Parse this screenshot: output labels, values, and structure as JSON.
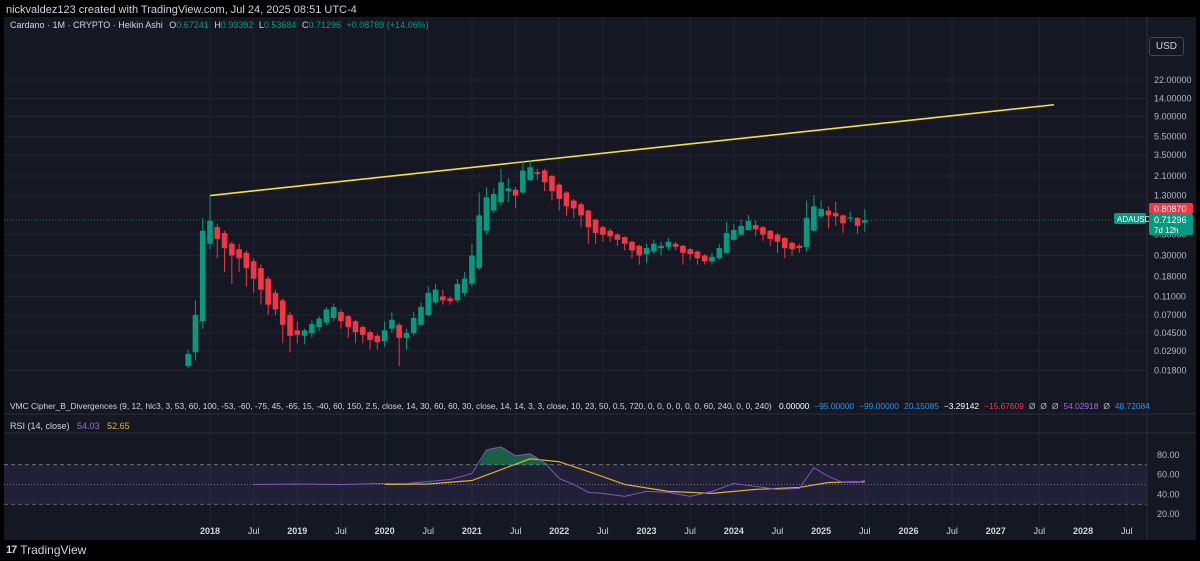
{
  "header": {
    "caption": "nickvaldez123 created with TradingView.com, Jul 24, 2025 08:51 UTC-4"
  },
  "symbol_info": {
    "symbol": "Cardano · 1M · CRYPTO · Heikin Ashi",
    "o_label": "O",
    "o": "0.67241",
    "h_label": "H",
    "h": "0.93392",
    "l_label": "L",
    "l": "0.53684",
    "c_label": "C",
    "c": "0.71296",
    "change": "+0.08789 (+14.06%)"
  },
  "currency_button": "USD",
  "price_labels": {
    "red_value": "0.80870",
    "ticker": "ADAUSD",
    "green_value": "0.71296",
    "countdown": "7d 12h"
  },
  "indicator1": {
    "text": "VMC Cipher_B_Divergences (9, 12, hlc3, 3, 53, 60, 100, -53, -60, -75, 45, -65, 15, -40, 60, 150, 2.5, close, 14, 30, 60, 60, 30, close, 14, 14, 3, 3, close, 10, 23, 50, 0.5, 720, 0, 0, 0, 0, 0, 0, 60, 240, 0, 0, 240)",
    "values": [
      {
        "t": "0.00000",
        "c": "#ffffff"
      },
      {
        "t": "−95.00000",
        "c": "#2196f3"
      },
      {
        "t": "−99.00000",
        "c": "#2196f3"
      },
      {
        "t": "20.15085",
        "c": "#2196f3"
      },
      {
        "t": "−3.29142",
        "c": "#ffffff"
      },
      {
        "t": "−15.67609",
        "c": "#f23645"
      },
      {
        "t": "Ø",
        "c": "#b2b5be"
      },
      {
        "t": "Ø",
        "c": "#b2b5be"
      },
      {
        "t": "Ø",
        "c": "#b2b5be"
      },
      {
        "t": "54.02918",
        "c": "#9c6ade"
      },
      {
        "t": "Ø",
        "c": "#b2b5be"
      },
      {
        "t": "48.72084",
        "c": "#2196f3"
      }
    ]
  },
  "rsi_legend": {
    "label": "RSI (14, close)",
    "rsi": "54.03",
    "ma": "52.65"
  },
  "footer": {
    "brand": "TradingView",
    "logo_text": "17"
  },
  "colors": {
    "bg": "#151823",
    "up": "#089981",
    "down": "#f23645",
    "trendline": "#f7e034",
    "rsi": "#7e57c2",
    "rsi_ma": "#d8b13a"
  },
  "chart_data": [
    {
      "type": "candlestick",
      "title": "Cardano · 1M · CRYPTO · Heikin Ashi",
      "style": "Heikin Ashi",
      "yscale": "log",
      "ylim": [
        0.012,
        60
      ],
      "xlim": [
        "2017-08",
        "2028-11"
      ],
      "grid": true,
      "y_ticks": [
        "22.00000",
        "14.00000",
        "9.00000",
        "5.50000",
        "3.50000",
        "2.10000",
        "1.30000",
        "0.50000",
        "0.30000",
        "0.18000",
        "0.11000",
        "0.07000",
        "0.04500",
        "0.02900",
        "0.01800"
      ],
      "x_ticks": [
        "2018",
        "Jul",
        "2019",
        "Jul",
        "2020",
        "Jul",
        "2021",
        "Jul",
        "2022",
        "Jul",
        "2023",
        "Jul",
        "2024",
        "Jul",
        "2025",
        "Jul",
        "2026",
        "Jul",
        "2027",
        "Jul",
        "2028",
        "Jul"
      ],
      "trendline": {
        "from": {
          "x": "2018-01",
          "y": 1.3
        },
        "to": {
          "x": "2027-09",
          "y": 12
        }
      },
      "candles": [
        {
          "x": "2017-10",
          "o": 0.02,
          "h": 0.03,
          "l": 0.019,
          "c": 0.027
        },
        {
          "x": "2017-11",
          "o": 0.028,
          "h": 0.1,
          "l": 0.023,
          "c": 0.07
        },
        {
          "x": "2017-12",
          "o": 0.06,
          "h": 0.75,
          "l": 0.05,
          "c": 0.55
        },
        {
          "x": "2018-01",
          "o": 0.4,
          "h": 1.3,
          "l": 0.35,
          "c": 0.7
        },
        {
          "x": "2018-02",
          "o": 0.6,
          "h": 0.65,
          "l": 0.28,
          "c": 0.45
        },
        {
          "x": "2018-03",
          "o": 0.52,
          "h": 0.55,
          "l": 0.2,
          "c": 0.36
        },
        {
          "x": "2018-04",
          "o": 0.4,
          "h": 0.42,
          "l": 0.15,
          "c": 0.3
        },
        {
          "x": "2018-05",
          "o": 0.35,
          "h": 0.4,
          "l": 0.2,
          "c": 0.28
        },
        {
          "x": "2018-06",
          "o": 0.32,
          "h": 0.34,
          "l": 0.14,
          "c": 0.22
        },
        {
          "x": "2018-07",
          "o": 0.26,
          "h": 0.28,
          "l": 0.12,
          "c": 0.17
        },
        {
          "x": "2018-08",
          "o": 0.22,
          "h": 0.24,
          "l": 0.09,
          "c": 0.13
        },
        {
          "x": "2018-09",
          "o": 0.17,
          "h": 0.18,
          "l": 0.07,
          "c": 0.09
        },
        {
          "x": "2018-10",
          "o": 0.12,
          "h": 0.13,
          "l": 0.07,
          "c": 0.08
        },
        {
          "x": "2018-11",
          "o": 0.1,
          "h": 0.105,
          "l": 0.035,
          "c": 0.055
        },
        {
          "x": "2018-12",
          "o": 0.07,
          "h": 0.075,
          "l": 0.028,
          "c": 0.042
        },
        {
          "x": "2019-01",
          "o": 0.048,
          "h": 0.06,
          "l": 0.035,
          "c": 0.043
        },
        {
          "x": "2019-02",
          "o": 0.042,
          "h": 0.05,
          "l": 0.034,
          "c": 0.048
        },
        {
          "x": "2019-03",
          "o": 0.045,
          "h": 0.062,
          "l": 0.04,
          "c": 0.056
        },
        {
          "x": "2019-04",
          "o": 0.052,
          "h": 0.068,
          "l": 0.047,
          "c": 0.064
        },
        {
          "x": "2019-05",
          "o": 0.058,
          "h": 0.085,
          "l": 0.055,
          "c": 0.08
        },
        {
          "x": "2019-06",
          "o": 0.065,
          "h": 0.092,
          "l": 0.06,
          "c": 0.085
        },
        {
          "x": "2019-07",
          "o": 0.075,
          "h": 0.08,
          "l": 0.05,
          "c": 0.06
        },
        {
          "x": "2019-08",
          "o": 0.068,
          "h": 0.07,
          "l": 0.04,
          "c": 0.052
        },
        {
          "x": "2019-09",
          "o": 0.06,
          "h": 0.062,
          "l": 0.035,
          "c": 0.046
        },
        {
          "x": "2019-10",
          "o": 0.052,
          "h": 0.054,
          "l": 0.035,
          "c": 0.043
        },
        {
          "x": "2019-11",
          "o": 0.046,
          "h": 0.048,
          "l": 0.03,
          "c": 0.038
        },
        {
          "x": "2019-12",
          "o": 0.042,
          "h": 0.044,
          "l": 0.03,
          "c": 0.036
        },
        {
          "x": "2020-01",
          "o": 0.037,
          "h": 0.06,
          "l": 0.032,
          "c": 0.048
        },
        {
          "x": "2020-02",
          "o": 0.05,
          "h": 0.075,
          "l": 0.045,
          "c": 0.062
        },
        {
          "x": "2020-03",
          "o": 0.055,
          "h": 0.058,
          "l": 0.02,
          "c": 0.04
        },
        {
          "x": "2020-04",
          "o": 0.04,
          "h": 0.05,
          "l": 0.03,
          "c": 0.045
        },
        {
          "x": "2020-05",
          "o": 0.045,
          "h": 0.075,
          "l": 0.042,
          "c": 0.065
        },
        {
          "x": "2020-06",
          "o": 0.055,
          "h": 0.095,
          "l": 0.053,
          "c": 0.085
        },
        {
          "x": "2020-07",
          "o": 0.07,
          "h": 0.14,
          "l": 0.068,
          "c": 0.12
        },
        {
          "x": "2020-08",
          "o": 0.095,
          "h": 0.15,
          "l": 0.09,
          "c": 0.13
        },
        {
          "x": "2020-09",
          "o": 0.11,
          "h": 0.13,
          "l": 0.09,
          "c": 0.1
        },
        {
          "x": "2020-10",
          "o": 0.105,
          "h": 0.11,
          "l": 0.09,
          "c": 0.098
        },
        {
          "x": "2020-11",
          "o": 0.1,
          "h": 0.17,
          "l": 0.095,
          "c": 0.15
        },
        {
          "x": "2020-12",
          "o": 0.12,
          "h": 0.2,
          "l": 0.11,
          "c": 0.17
        },
        {
          "x": "2021-01",
          "o": 0.15,
          "h": 0.4,
          "l": 0.14,
          "c": 0.3
        },
        {
          "x": "2021-02",
          "o": 0.22,
          "h": 1.4,
          "l": 0.21,
          "c": 0.8
        },
        {
          "x": "2021-03",
          "o": 0.55,
          "h": 1.6,
          "l": 0.5,
          "c": 1.25
        },
        {
          "x": "2021-04",
          "o": 0.9,
          "h": 1.55,
          "l": 0.85,
          "c": 1.35
        },
        {
          "x": "2021-05",
          "o": 1.1,
          "h": 2.5,
          "l": 1.0,
          "c": 1.8
        },
        {
          "x": "2021-06",
          "o": 1.45,
          "h": 2.0,
          "l": 1.1,
          "c": 1.55
        },
        {
          "x": "2021-07",
          "o": 1.5,
          "h": 1.6,
          "l": 0.95,
          "c": 1.3
        },
        {
          "x": "2021-08",
          "o": 1.4,
          "h": 3.0,
          "l": 1.35,
          "c": 2.4
        },
        {
          "x": "2021-09",
          "o": 1.9,
          "h": 3.1,
          "l": 1.85,
          "c": 2.6
        },
        {
          "x": "2021-10",
          "o": 2.3,
          "h": 2.5,
          "l": 1.9,
          "c": 2.2
        },
        {
          "x": "2021-11",
          "o": 2.4,
          "h": 2.5,
          "l": 1.45,
          "c": 1.8
        },
        {
          "x": "2021-12",
          "o": 2.1,
          "h": 2.15,
          "l": 1.15,
          "c": 1.45
        },
        {
          "x": "2022-01",
          "o": 1.7,
          "h": 1.75,
          "l": 0.9,
          "c": 1.2
        },
        {
          "x": "2022-02",
          "o": 1.4,
          "h": 1.45,
          "l": 0.8,
          "c": 1.0
        },
        {
          "x": "2022-03",
          "o": 1.15,
          "h": 1.2,
          "l": 0.75,
          "c": 0.95
        },
        {
          "x": "2022-04",
          "o": 1.05,
          "h": 1.1,
          "l": 0.6,
          "c": 0.8
        },
        {
          "x": "2022-05",
          "o": 0.9,
          "h": 0.92,
          "l": 0.4,
          "c": 0.6
        },
        {
          "x": "2022-06",
          "o": 0.72,
          "h": 0.74,
          "l": 0.4,
          "c": 0.52
        },
        {
          "x": "2022-07",
          "o": 0.6,
          "h": 0.62,
          "l": 0.42,
          "c": 0.5
        },
        {
          "x": "2022-08",
          "o": 0.55,
          "h": 0.58,
          "l": 0.42,
          "c": 0.48
        },
        {
          "x": "2022-09",
          "o": 0.5,
          "h": 0.52,
          "l": 0.38,
          "c": 0.44
        },
        {
          "x": "2022-10",
          "o": 0.47,
          "h": 0.48,
          "l": 0.34,
          "c": 0.4
        },
        {
          "x": "2022-11",
          "o": 0.42,
          "h": 0.43,
          "l": 0.28,
          "c": 0.34
        },
        {
          "x": "2022-12",
          "o": 0.38,
          "h": 0.39,
          "l": 0.24,
          "c": 0.3
        },
        {
          "x": "2023-01",
          "o": 0.31,
          "h": 0.4,
          "l": 0.25,
          "c": 0.36
        },
        {
          "x": "2023-02",
          "o": 0.33,
          "h": 0.44,
          "l": 0.31,
          "c": 0.4
        },
        {
          "x": "2023-03",
          "o": 0.36,
          "h": 0.42,
          "l": 0.3,
          "c": 0.38
        },
        {
          "x": "2023-04",
          "o": 0.37,
          "h": 0.46,
          "l": 0.34,
          "c": 0.42
        },
        {
          "x": "2023-05",
          "o": 0.4,
          "h": 0.42,
          "l": 0.34,
          "c": 0.37
        },
        {
          "x": "2023-06",
          "o": 0.38,
          "h": 0.39,
          "l": 0.24,
          "c": 0.32
        },
        {
          "x": "2023-07",
          "o": 0.35,
          "h": 0.36,
          "l": 0.27,
          "c": 0.31
        },
        {
          "x": "2023-08",
          "o": 0.33,
          "h": 0.34,
          "l": 0.24,
          "c": 0.28
        },
        {
          "x": "2023-09",
          "o": 0.3,
          "h": 0.31,
          "l": 0.24,
          "c": 0.26
        },
        {
          "x": "2023-10",
          "o": 0.26,
          "h": 0.32,
          "l": 0.24,
          "c": 0.29
        },
        {
          "x": "2023-11",
          "o": 0.28,
          "h": 0.4,
          "l": 0.27,
          "c": 0.36
        },
        {
          "x": "2023-12",
          "o": 0.32,
          "h": 0.68,
          "l": 0.31,
          "c": 0.52
        },
        {
          "x": "2024-01",
          "o": 0.44,
          "h": 0.65,
          "l": 0.43,
          "c": 0.56
        },
        {
          "x": "2024-02",
          "o": 0.5,
          "h": 0.72,
          "l": 0.48,
          "c": 0.62
        },
        {
          "x": "2024-03",
          "o": 0.56,
          "h": 0.81,
          "l": 0.55,
          "c": 0.7
        },
        {
          "x": "2024-04",
          "o": 0.63,
          "h": 0.7,
          "l": 0.48,
          "c": 0.57
        },
        {
          "x": "2024-05",
          "o": 0.6,
          "h": 0.62,
          "l": 0.43,
          "c": 0.5
        },
        {
          "x": "2024-06",
          "o": 0.55,
          "h": 0.56,
          "l": 0.38,
          "c": 0.45
        },
        {
          "x": "2024-07",
          "o": 0.5,
          "h": 0.52,
          "l": 0.32,
          "c": 0.42
        },
        {
          "x": "2024-08",
          "o": 0.46,
          "h": 0.47,
          "l": 0.28,
          "c": 0.36
        },
        {
          "x": "2024-09",
          "o": 0.41,
          "h": 0.42,
          "l": 0.3,
          "c": 0.35
        },
        {
          "x": "2024-10",
          "o": 0.38,
          "h": 0.4,
          "l": 0.32,
          "c": 0.36
        },
        {
          "x": "2024-11",
          "o": 0.37,
          "h": 1.15,
          "l": 0.33,
          "c": 0.75
        },
        {
          "x": "2024-12",
          "o": 0.55,
          "h": 1.32,
          "l": 0.54,
          "c": 1.0
        },
        {
          "x": "2025-01",
          "o": 0.78,
          "h": 1.15,
          "l": 0.74,
          "c": 0.94
        },
        {
          "x": "2025-02",
          "o": 0.9,
          "h": 1.0,
          "l": 0.58,
          "c": 0.8
        },
        {
          "x": "2025-03",
          "o": 0.85,
          "h": 1.12,
          "l": 0.62,
          "c": 0.78
        },
        {
          "x": "2025-04",
          "o": 0.8,
          "h": 0.82,
          "l": 0.52,
          "c": 0.66
        },
        {
          "x": "2025-05",
          "o": 0.74,
          "h": 0.88,
          "l": 0.68,
          "c": 0.76
        },
        {
          "x": "2025-06",
          "o": 0.75,
          "h": 0.77,
          "l": 0.51,
          "c": 0.62
        },
        {
          "x": "2025-07",
          "o": 0.67241,
          "h": 0.93392,
          "l": 0.53684,
          "c": 0.71296
        }
      ]
    },
    {
      "type": "line",
      "title": "RSI (14, close)",
      "ylim": [
        12,
        95
      ],
      "y_ticks": [
        "80.00",
        "60.00",
        "40.00",
        "20.00"
      ],
      "bands": [
        70,
        50,
        30
      ],
      "series": [
        {
          "name": "RSI",
          "x": [
            "2018-07",
            "2019-01",
            "2019-07",
            "2020-01",
            "2020-04",
            "2020-07",
            "2020-10",
            "2021-01",
            "2021-03",
            "2021-05",
            "2021-07",
            "2021-09",
            "2021-11",
            "2022-01",
            "2022-03",
            "2022-05",
            "2022-07",
            "2022-10",
            "2023-01",
            "2023-04",
            "2023-07",
            "2023-10",
            "2024-01",
            "2024-04",
            "2024-07",
            "2024-10",
            "2024-12",
            "2025-02",
            "2025-04",
            "2025-06",
            "2025-07"
          ],
          "values": [
            50,
            50.5,
            50,
            51,
            51,
            53,
            55,
            61,
            85,
            88,
            79,
            81,
            72,
            56,
            50,
            42,
            41,
            38,
            43,
            42,
            38,
            43,
            51,
            48,
            45,
            46,
            67,
            58,
            52,
            52,
            54.03
          ]
        },
        {
          "name": "MA",
          "x": [
            "2020-01",
            "2020-07",
            "2021-01",
            "2021-05",
            "2021-09",
            "2022-01",
            "2022-05",
            "2022-10",
            "2023-04",
            "2023-10",
            "2024-04",
            "2024-10",
            "2025-02",
            "2025-07"
          ],
          "values": [
            50,
            50.5,
            54,
            65,
            76,
            73,
            63,
            50,
            43,
            41,
            45,
            47,
            52,
            52.65
          ]
        }
      ]
    }
  ]
}
